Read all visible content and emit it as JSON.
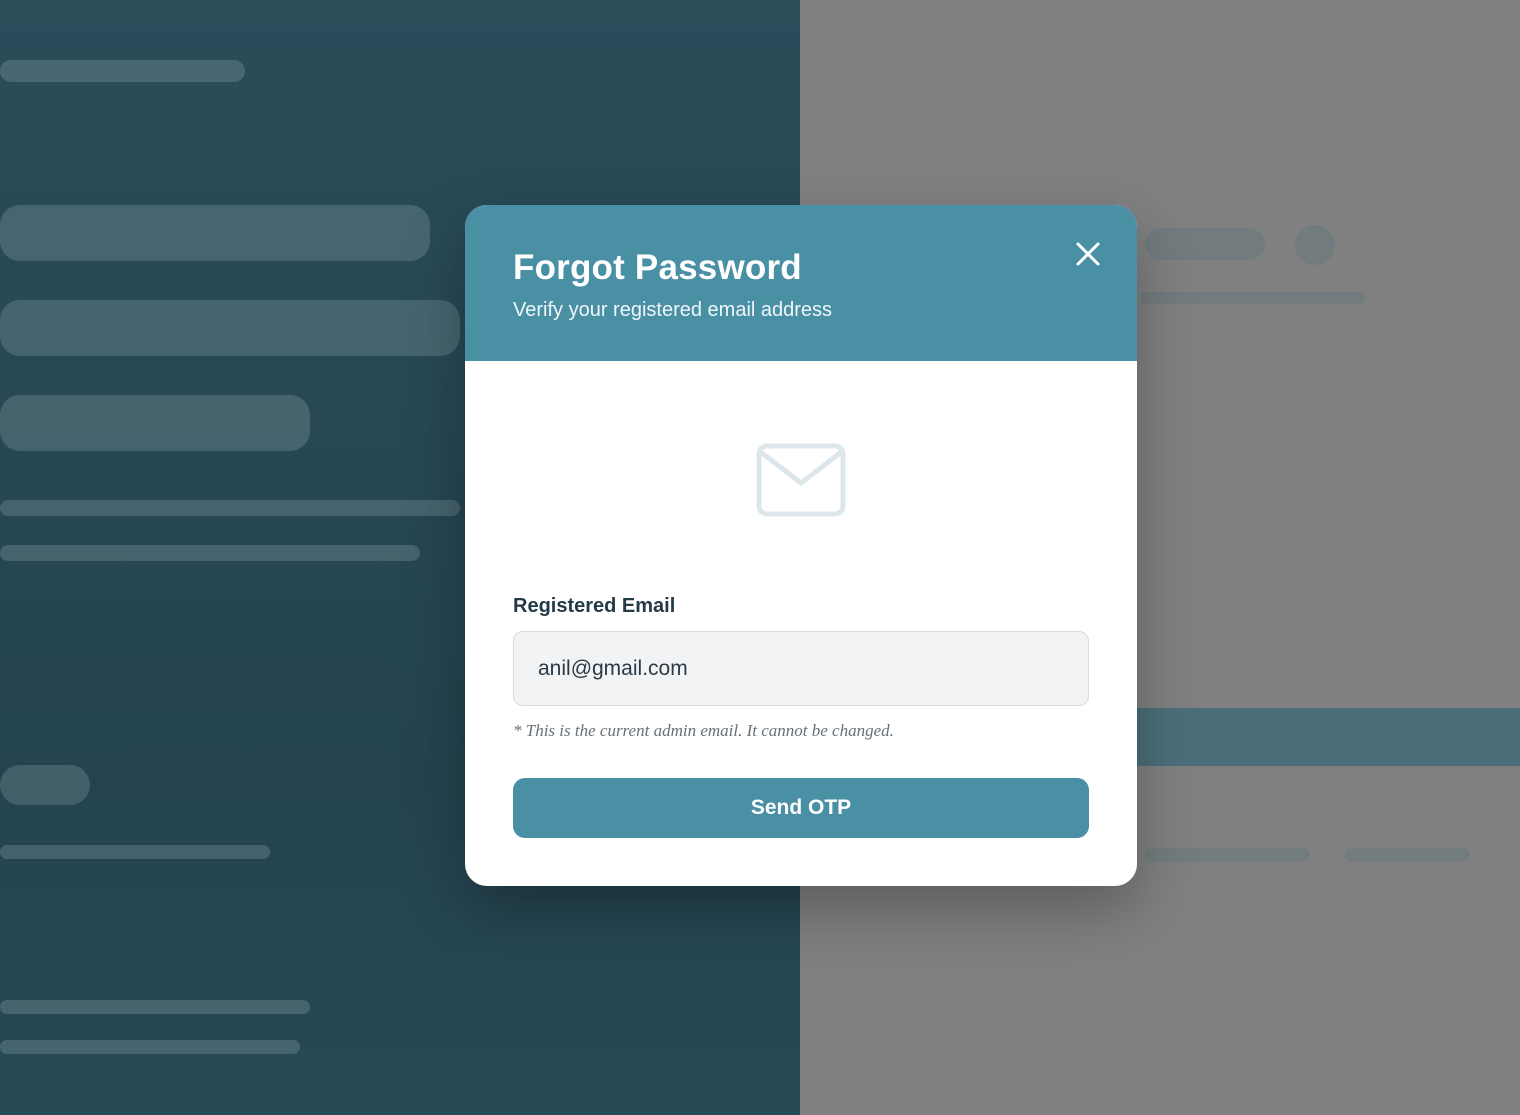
{
  "modal": {
    "title": "Forgot Password",
    "subtitle": "Verify your registered email address",
    "close_icon": "close-icon",
    "mail_icon": "mail-icon",
    "email_label": "Registered Email",
    "email_value": "anil@gmail.com",
    "hint": "* This is the current admin email. It cannot be changed.",
    "send_button": "Send OTP"
  },
  "colors": {
    "header": "#4a90a5",
    "button": "#4a90a5",
    "input_bg": "#f2f3f5",
    "label": "#243b47"
  }
}
